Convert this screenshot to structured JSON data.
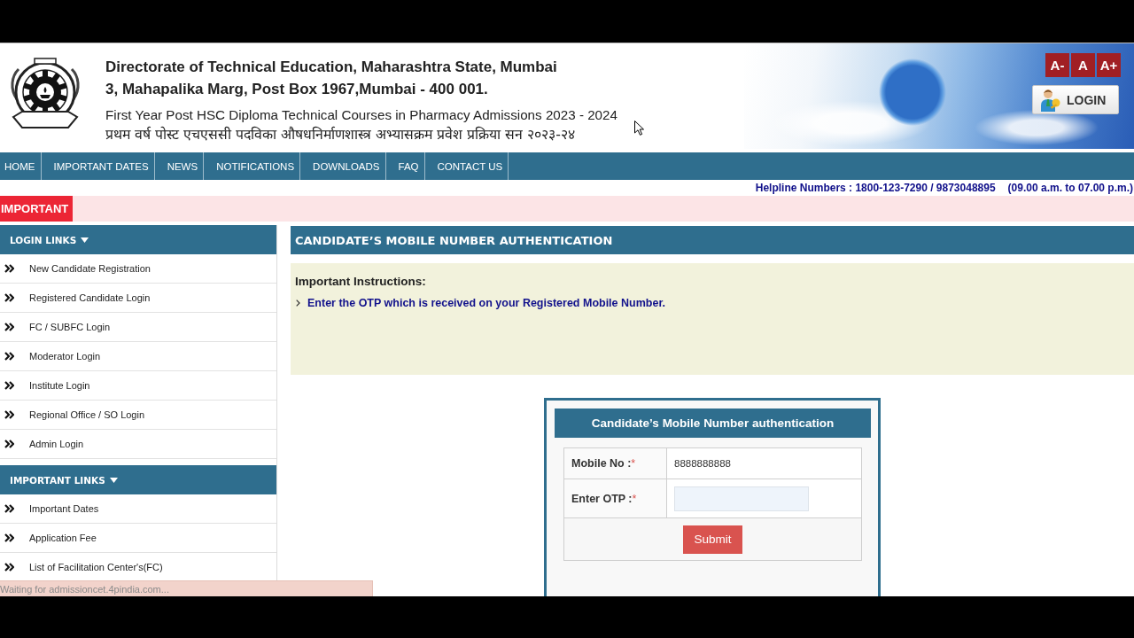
{
  "header": {
    "title": "Directorate of Technical Education, Maharashtra State, Mumbai",
    "address": "3, Mahapalika Marg, Post Box 1967,Mumbai - 400 001.",
    "course_en": "First Year Post HSC Diploma Technical Courses in Pharmacy Admissions 2023 - 2024",
    "course_hi": "प्रथम वर्ष पोस्ट एचएससी पदविका औषधनिर्माणशास्त्र अभ्यासक्रम प्रवेश प्रक्रिया सन २०२३-२४",
    "font_buttons": [
      "A-",
      "A",
      "A+"
    ],
    "login_button": "LOGIN"
  },
  "nav": {
    "items": [
      "HOME",
      "IMPORTANT DATES",
      "NEWS",
      "NOTIFICATIONS",
      "DOWNLOADS",
      "FAQ",
      "CONTACT US"
    ]
  },
  "helpline": {
    "numbers": "Helpline Numbers : 1800-123-7290 / 9873048895",
    "hours": "(09.00 a.m. to 07.00 p.m.)"
  },
  "ticker": {
    "label": "IMPORTANT"
  },
  "sidebar": {
    "sections": [
      {
        "title": "LOGIN LINKS",
        "items": [
          "New Candidate Registration",
          "Registered Candidate Login",
          "FC / SUBFC Login",
          "Moderator Login",
          "Institute Login",
          "Regional Office / SO Login",
          "Admin Login"
        ]
      },
      {
        "title": "IMPORTANT LINKS",
        "items": [
          "Important Dates",
          "Application Fee",
          "List of Facilitation Center's(FC)"
        ]
      }
    ]
  },
  "main": {
    "heading": "CANDIDATE’S MOBILE NUMBER AUTHENTICATION",
    "instructions": {
      "title": "Important Instructions:",
      "items": [
        "Enter the OTP which is received on your Registered Mobile Number."
      ]
    },
    "form": {
      "title": "Candidate’s Mobile Number authentication",
      "fields": [
        {
          "kind": "text",
          "label": "Mobile No :",
          "required_mark": "*",
          "value": "8888888888"
        },
        {
          "kind": "input",
          "label": "Enter OTP :",
          "required_mark": "*"
        }
      ],
      "submit": "Submit"
    }
  },
  "status_bar": {
    "text": "Waiting for admissioncet.4pindia.com..."
  }
}
